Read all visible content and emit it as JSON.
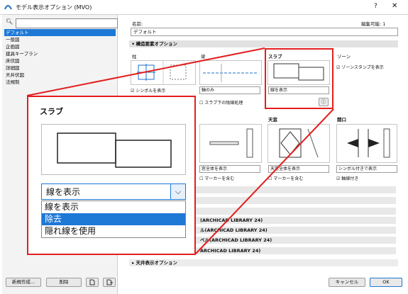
{
  "window": {
    "title": "モデル表示オプション (MVO)",
    "help": "?",
    "close": "✕"
  },
  "search": {
    "placeholder": ""
  },
  "sidebar": {
    "items": [
      "デフォルト",
      "一般図",
      "企画図",
      "建具キープラン",
      "床伏図",
      "詳細図",
      "天井伏図",
      "法規制"
    ]
  },
  "left_buttons": {
    "new": "新規作成...",
    "delete": "削除"
  },
  "header": {
    "name_label": "名前:",
    "name_value": "デフォルト",
    "editable": "編集可能: 1"
  },
  "section": {
    "structural": "構造要素オプション",
    "ceiling": "天井表示オプション"
  },
  "panels": {
    "column": {
      "title": "柱",
      "checkbox": "シンボルを表示"
    },
    "beam": {
      "title": "梁",
      "dropdown": "軸のみ",
      "checkbox": "スラブ下の陰線処理"
    },
    "slab": {
      "title": "スラブ",
      "dropdown": "線を表示"
    },
    "zone": {
      "title": "ゾーン",
      "checkbox": "ゾーンスタンプを表示"
    },
    "door": {
      "dropdown": "窓全体を表示",
      "checkbox": "マーカーを含む"
    },
    "skylight": {
      "title": "天窓",
      "dropdown": "天窓全体を表示",
      "checkbox": "マーカーを含む"
    },
    "opening": {
      "title": "開口",
      "dropdown": "シンボル付きで表示",
      "checkbox": "軸線付き"
    }
  },
  "library_rows": [
    "(ARCHICAD LIBRARY 24)",
    "ル(ARCHICAD LIBRARY 24)",
    "ベル(ARCHICAD LIBRARY 24)",
    "ARCHICAD LIBRARY 24)"
  ],
  "zoom": {
    "title": "スラブ",
    "selected": "線を表示",
    "options": [
      "線を表示",
      "除去",
      "隠れ線を使用"
    ],
    "highlighted_index": 1
  },
  "footer": {
    "cancel": "キャンセル",
    "ok": "OK"
  },
  "colors": {
    "accent": "#1e78d6",
    "callout": "#e31e1e"
  }
}
